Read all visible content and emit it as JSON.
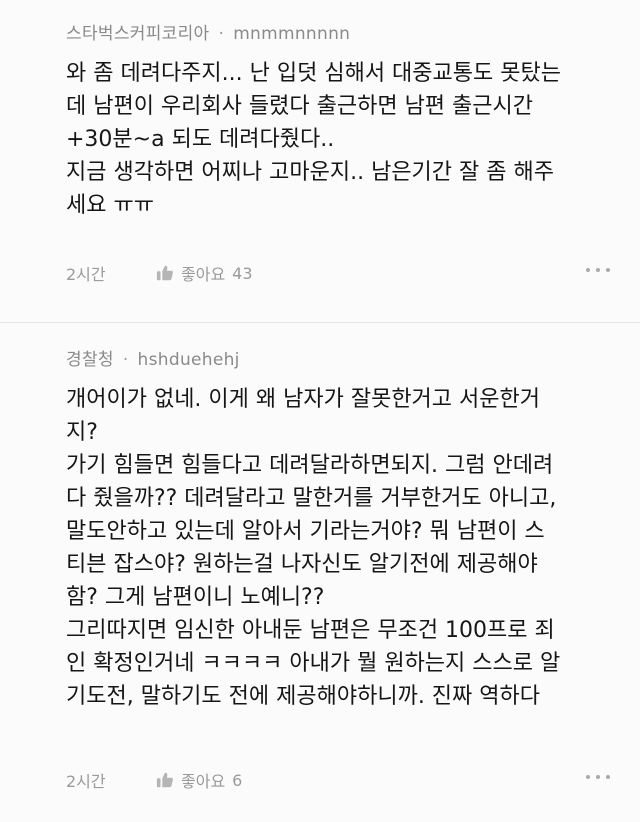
{
  "comments": [
    {
      "author": "스타벅스커피코리아",
      "separator": "·",
      "nickname": "mnmmnnnnn",
      "lines": [
        "와 좀 데려다주지... 난 입덧 심해서 대중교통도 못탔는",
        "데 남편이 우리회사 들렸다 출근하면 남편 출근시간",
        "+30분~a 되도 데려다줬다..",
        "지금 생각하면 어찌나 고마운지.. 남은기간 잘 좀 해주",
        "세요 ㅠㅠ"
      ],
      "time": "2시간",
      "like_label": "좋아요",
      "like_count": "43",
      "like_icon": "thumbs-up-icon",
      "more_icon": "more-dots-icon"
    },
    {
      "author": "경찰청",
      "separator": "·",
      "nickname": "hshduehehj",
      "lines": [
        "개어이가 없네. 이게 왜 남자가 잘못한거고 서운한거",
        "지?",
        "가기 힘들면 힘들다고 데려달라하면되지. 그럼 안데려",
        "다 줬을까?? 데려달라고 말한거를 거부한거도 아니고,",
        "말도안하고 있는데 알아서 기라는거야? 뭐 남편이 스",
        "티븐 잡스야? 원하는걸 나자신도 알기전에 제공해야",
        "함? 그게 남편이니 노예니??",
        "그리따지면 임신한 아내둔 남편은 무조건 100프로 죄",
        "인 확정인거네 ㅋㅋㅋㅋ 아내가 뭘 원하는지 스스로 알",
        "기도전, 말하기도 전에 제공해야하니까. 진짜 역하다"
      ],
      "time": "2시간",
      "like_label": "좋아요",
      "like_count": "6",
      "like_icon": "thumbs-up-icon",
      "more_icon": "more-dots-icon"
    }
  ]
}
